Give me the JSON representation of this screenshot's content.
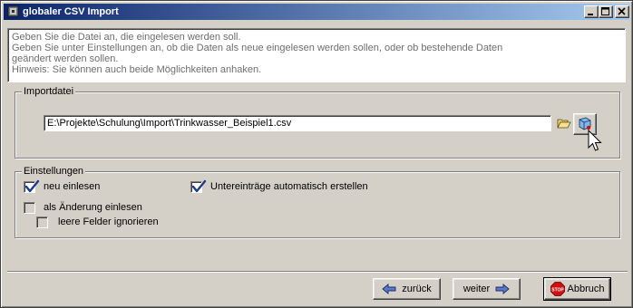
{
  "window": {
    "title": "globaler CSV Import",
    "controls": [
      "minimize-icon",
      "maximize-icon",
      "close-icon"
    ]
  },
  "info": {
    "lines": [
      "Geben Sie die Datei an, die eingelesen werden soll.",
      "Geben Sie unter Einstellungen an, ob die Daten als neue eingelesen werden sollen, oder ob bestehende Daten",
      "geändert werden sollen.",
      "Hinweis: Sie können auch beide Möglichkeiten anhaken."
    ]
  },
  "importdatei": {
    "group_label": "Importdatei",
    "path_value": "E:\\Projekte\\Schulung\\Import\\Trinkwasser_Beispiel1.csv"
  },
  "einstellungen": {
    "group_label": "Einstellungen",
    "neu_einlesen": {
      "label": "neu einlesen",
      "checked": true
    },
    "untereintraege": {
      "label": "Untereinträge automatisch erstellen",
      "checked": true
    },
    "als_aenderung": {
      "label": "als Änderung einlesen",
      "checked": false
    },
    "leere_felder": {
      "label": "leere Felder ignorieren",
      "checked": false
    }
  },
  "footer": {
    "back_label": "zurück",
    "next_label": "weiter",
    "cancel_label": "Abbruch",
    "stop_sign_text": "STOP"
  },
  "colors": {
    "title_gradient_start": "#0a246a",
    "title_gradient_end": "#a6caf0",
    "check_color": "#1c3b8c",
    "stop_red": "#d01010"
  }
}
